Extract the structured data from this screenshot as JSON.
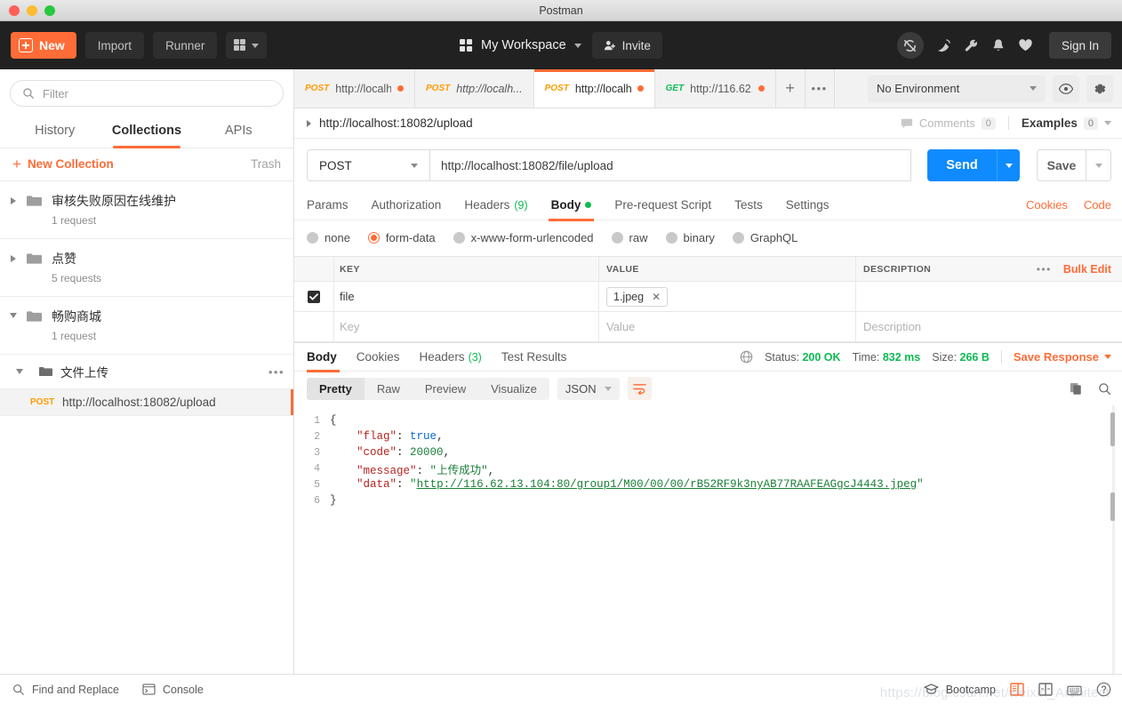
{
  "window": {
    "title": "Postman"
  },
  "toolbar": {
    "new_label": "New",
    "import_label": "Import",
    "runner_label": "Runner",
    "workspace_label": "My Workspace",
    "invite_label": "Invite",
    "signin_label": "Sign In",
    "icons": [
      "sync-off-icon",
      "satellite-icon",
      "wrench-icon",
      "bell-icon",
      "heart-icon"
    ]
  },
  "sidebar": {
    "filter_placeholder": "Filter",
    "tabs": [
      {
        "label": "History",
        "active": false
      },
      {
        "label": "Collections",
        "active": true
      },
      {
        "label": "APIs",
        "active": false
      }
    ],
    "new_collection_label": "New Collection",
    "trash_label": "Trash",
    "collections": [
      {
        "name": "审核失败原因在线维护",
        "sub": "1 request",
        "expanded": false
      },
      {
        "name": "点赞",
        "sub": "5 requests",
        "expanded": false
      },
      {
        "name": "畅购商城",
        "sub": "1 request",
        "expanded": true
      }
    ],
    "sub_folder": {
      "name": "文件上传",
      "expanded": true
    },
    "request": {
      "method": "POST",
      "url": "http://localhost:18082/upload",
      "selected": true
    }
  },
  "tabstrip": {
    "tabs": [
      {
        "method": "POST",
        "url": "http://localh...",
        "active": false,
        "unsaved": true,
        "italic": false
      },
      {
        "method": "POST",
        "url": "http://localh...",
        "active": false,
        "unsaved": false,
        "italic": true
      },
      {
        "method": "POST",
        "url": "http://localh...",
        "active": true,
        "unsaved": true,
        "italic": false
      },
      {
        "method": "GET",
        "url": "http://116.62....",
        "active": false,
        "unsaved": true,
        "italic": false
      }
    ],
    "add_label": "+",
    "more_label": "•••",
    "environment": "No Environment"
  },
  "request": {
    "name": "http://localhost:18082/upload",
    "comments_label": "Comments",
    "comments_count": "0",
    "examples_label": "Examples",
    "examples_count": "0",
    "method": "POST",
    "url": "http://localhost:18082/file/upload",
    "send_label": "Send",
    "save_label": "Save",
    "tabs": [
      {
        "label": "Params",
        "active": false,
        "count": null,
        "dot": false
      },
      {
        "label": "Authorization",
        "active": false,
        "count": null,
        "dot": false
      },
      {
        "label": "Headers",
        "active": false,
        "count": "(9)",
        "dot": false
      },
      {
        "label": "Body",
        "active": true,
        "count": null,
        "dot": true
      },
      {
        "label": "Pre-request Script",
        "active": false,
        "count": null,
        "dot": false
      },
      {
        "label": "Tests",
        "active": false,
        "count": null,
        "dot": false
      },
      {
        "label": "Settings",
        "active": false,
        "count": null,
        "dot": false
      }
    ],
    "cookies_label": "Cookies",
    "code_label": "Code",
    "body_types": [
      {
        "label": "none",
        "selected": false
      },
      {
        "label": "form-data",
        "selected": true
      },
      {
        "label": "x-www-form-urlencoded",
        "selected": false
      },
      {
        "label": "raw",
        "selected": false
      },
      {
        "label": "binary",
        "selected": false
      },
      {
        "label": "GraphQL",
        "selected": false
      }
    ],
    "table": {
      "headers": {
        "key": "KEY",
        "value": "VALUE",
        "description": "DESCRIPTION"
      },
      "bulk_edit_label": "Bulk Edit",
      "rows": [
        {
          "checked": true,
          "key": "file",
          "file_chip": "1.jpeg",
          "description": ""
        }
      ],
      "placeholder_row": {
        "key": "Key",
        "value": "Value",
        "description": "Description"
      }
    }
  },
  "response": {
    "tabs": [
      {
        "label": "Body",
        "active": true,
        "count": null
      },
      {
        "label": "Cookies",
        "active": false,
        "count": null
      },
      {
        "label": "Headers",
        "active": false,
        "count": "(3)"
      },
      {
        "label": "Test Results",
        "active": false,
        "count": null
      }
    ],
    "status_label": "Status:",
    "status_value": "200 OK",
    "time_label": "Time:",
    "time_value": "832 ms",
    "size_label": "Size:",
    "size_value": "266 B",
    "save_response_label": "Save Response",
    "view_modes": [
      {
        "label": "Pretty",
        "active": true
      },
      {
        "label": "Raw",
        "active": false
      },
      {
        "label": "Preview",
        "active": false
      },
      {
        "label": "Visualize",
        "active": false
      }
    ],
    "format": "JSON",
    "body_lines": [
      {
        "n": "1",
        "text": "{"
      },
      {
        "n": "2",
        "text": "    \"flag\": true,"
      },
      {
        "n": "3",
        "text": "    \"code\": 20000,"
      },
      {
        "n": "4",
        "text": "    \"message\": \"上传成功\","
      },
      {
        "n": "5",
        "text": "    \"data\": \"http://116.62.13.104:80/group1/M00/00/00/rB52RF9k3nyAB77RAAFEAGgcJ4443.jpeg\""
      },
      {
        "n": "6",
        "text": "}"
      }
    ],
    "json": {
      "flag": "true",
      "code": "20000",
      "message": "上传成功",
      "data": "http://116.62.13.104:80/group1/M00/00/00/rB52RF9k3nyAB77RAAFEAGgcJ4443.jpeg"
    }
  },
  "footer": {
    "find_replace_label": "Find and Replace",
    "console_label": "Console",
    "bootcamp_label": "Bootcamp",
    "watermark": "https://blog.csdn.net/weixin_Architect"
  }
}
